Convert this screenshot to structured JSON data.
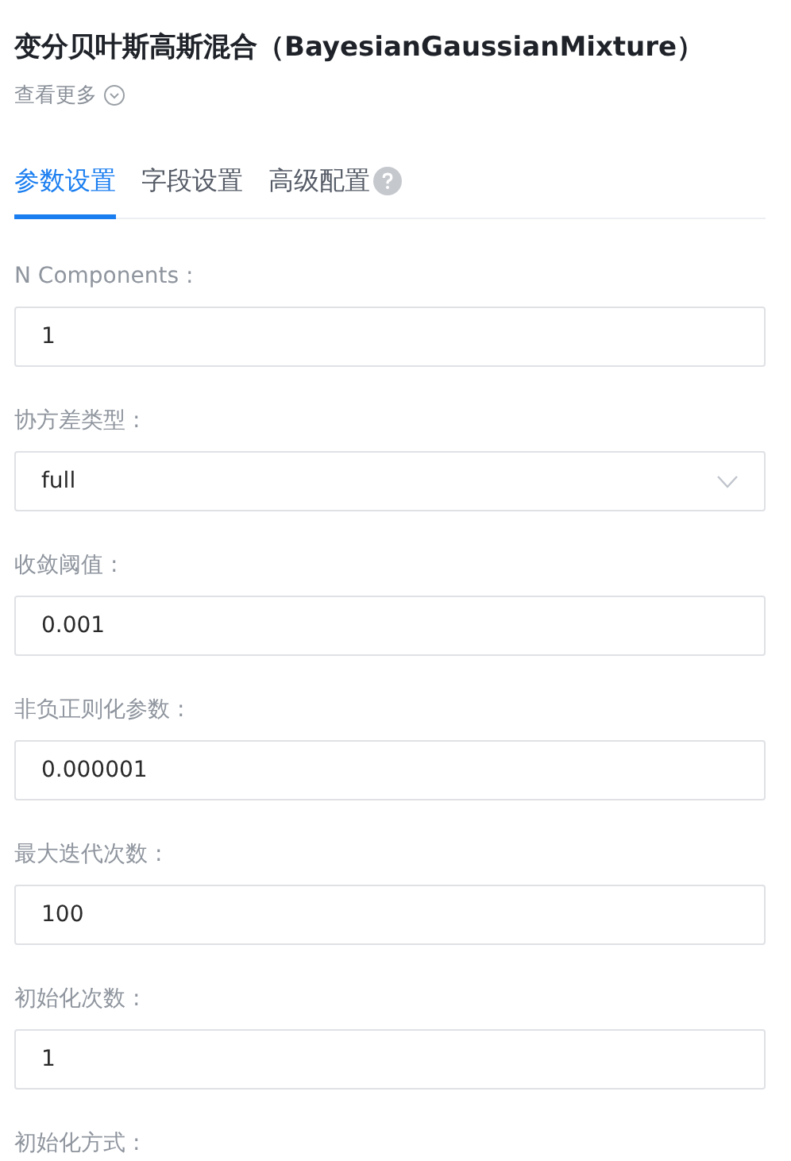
{
  "title": "变分贝叶斯高斯混合（BayesianGaussianMixture）",
  "more_link": "查看更多",
  "tabs": [
    {
      "label": "参数设置",
      "selected": true,
      "help": false
    },
    {
      "label": "字段设置",
      "selected": false,
      "help": false
    },
    {
      "label": "高级配置",
      "selected": false,
      "help": true
    }
  ],
  "fields": [
    {
      "label": "N Components :",
      "kind": "input",
      "value": "1"
    },
    {
      "label": "协方差类型 :",
      "kind": "select",
      "value": "full"
    },
    {
      "label": "收敛阈值 :",
      "kind": "input",
      "value": "0.001"
    },
    {
      "label": "非负正则化参数 :",
      "kind": "input",
      "value": "0.000001"
    },
    {
      "label": "最大迭代次数 :",
      "kind": "input",
      "value": "100"
    },
    {
      "label": "初始化次数 :",
      "kind": "input",
      "value": "1"
    },
    {
      "label": "初始化方式 :",
      "kind": "label_only"
    }
  ]
}
